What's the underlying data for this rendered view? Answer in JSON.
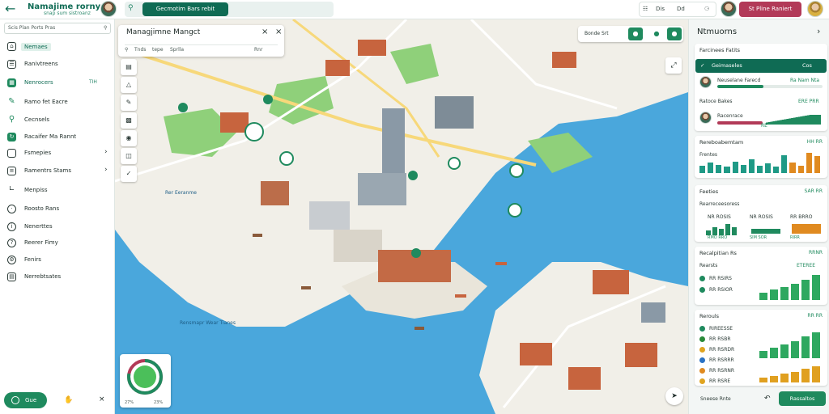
{
  "topbar": {
    "app_title": "Namajime rorny",
    "app_subtitle": "snap sum sistroanz",
    "search_button": "Gecmotim Bars rebit",
    "toolbar_items": [
      "Dis",
      "Dd"
    ],
    "cta_label": "St Pline Raniert"
  },
  "sidebar": {
    "search_placeholder": "Scis Plan Ports Pras",
    "items": [
      {
        "label": "Nemaes",
        "icon": "home-icon",
        "active": true
      },
      {
        "label": "Ranivtreens",
        "icon": "layers-icon"
      },
      {
        "label": "Nenrocers",
        "icon": "map-icon",
        "count": "TIH",
        "highlight": true
      },
      {
        "label": "Ramo fet Eacre",
        "icon": "pen-icon"
      },
      {
        "label": "Cecnsels",
        "icon": "search-icon"
      },
      {
        "label": "Racaifer Ma Rannt",
        "icon": "route-icon"
      },
      {
        "label": "Fsmepies",
        "icon": "folder-icon",
        "chevron": true
      },
      {
        "label": "Ramentrs Stams",
        "icon": "list-icon",
        "chevron": true
      },
      {
        "label": "Menpiss",
        "icon": "chart-icon"
      },
      {
        "label": "Roosto Rans",
        "icon": "clock-icon"
      },
      {
        "label": "Nenerttes",
        "icon": "info-icon"
      },
      {
        "label": "Reerer Fimy",
        "icon": "help-icon"
      },
      {
        "label": "Fenirs",
        "icon": "settings-icon"
      },
      {
        "label": "Nerrebtsates",
        "icon": "doc-icon"
      }
    ],
    "footer_button": "Gue"
  },
  "map": {
    "search_title": "Managjimne Mangct",
    "search_sub": [
      "Tnds",
      "tepe",
      "Sprlla",
      "Rnr"
    ],
    "toolbar_label": "Bonde Srt",
    "sea_labels": [
      "Rer Eeranme",
      "Rensmapr Wear Tianes"
    ],
    "donut": {
      "value": 0.78,
      "labels": [
        "27%",
        "23%"
      ]
    }
  },
  "right_panel": {
    "title": "Ntmuorns",
    "card1": {
      "title": "Farcinees Fatits",
      "highlight": {
        "label": "Geimaseles",
        "value": "Cos"
      },
      "rows": [
        {
          "label": "Neuselane Farecd",
          "value": "Ra Nam Nta",
          "progress": 0.44
        },
        {
          "label": "Ratoce Bakes",
          "value": "ERE PRR",
          "progress": 0
        },
        {
          "label": "Racenrace",
          "value": "RE",
          "progress": 0.5
        }
      ]
    },
    "card2": {
      "title": "Rereboabemtam",
      "value": "HH RR",
      "sub": "Frentes",
      "bars": [
        0.35,
        0.5,
        0.4,
        0.3,
        0.55,
        0.4,
        0.65,
        0.35,
        0.45,
        0.3,
        0.85,
        0.5,
        0.35,
        0.95,
        0.8
      ]
    },
    "card3": {
      "title": "Feeties",
      "value": "SAR RR",
      "sub": "Rearreceesoress",
      "cols": [
        {
          "label": "NR ROSIS",
          "value": "RMO RRO"
        },
        {
          "label": "NR ROSIS",
          "value": "SIM SOR"
        },
        {
          "label": "RR BRRO",
          "value": "RIRR"
        }
      ]
    },
    "card4": {
      "title": "Recalpitian Rs",
      "value": "RRNR",
      "rows": [
        {
          "label": "Rearsts",
          "value": "ETEREE"
        },
        {
          "label": "RR RSIRS"
        },
        {
          "label": "RR RSIOR"
        }
      ],
      "bars": [
        0.25,
        0.35,
        0.45,
        0.55,
        0.7,
        0.85
      ]
    },
    "card5": {
      "title": "Rerouls",
      "value": "RR RR",
      "rows": [
        {
          "label": "RIREESSE",
          "color": "#1f8a5e"
        },
        {
          "label": "RR RSBR",
          "color": "#2a8a3a"
        },
        {
          "label": "RR RSRDR",
          "color": "#e0a420"
        },
        {
          "label": "RR RSRRR",
          "color": "#2b72c4"
        },
        {
          "label": "RR RSRNR",
          "color": "#e08a20"
        },
        {
          "label": "RR RSRE",
          "color": "#e0a420"
        }
      ],
      "bars": [
        0.25,
        0.35,
        0.45,
        0.55,
        0.7,
        0.85
      ]
    },
    "footer_label": "Sneese Rnte",
    "footer_button": "Rassaltos"
  }
}
